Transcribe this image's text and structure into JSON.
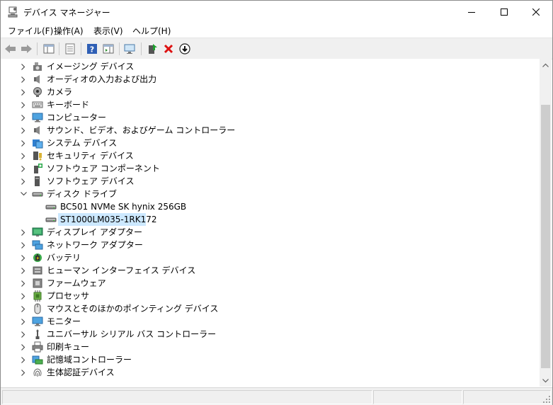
{
  "window": {
    "title": "デバイス マネージャー"
  },
  "menu": [
    {
      "label": "ファイル(F)",
      "name": "menu-file"
    },
    {
      "label": "操作(A)",
      "name": "menu-action"
    },
    {
      "label": "表示(V)",
      "name": "menu-view"
    },
    {
      "label": "ヘルプ(H)",
      "name": "menu-help"
    }
  ],
  "tree": {
    "items": [
      {
        "label": "イメージング デバイス",
        "icon": "camera-device-icon",
        "state": "collapsed"
      },
      {
        "label": "オーディオの入力および出力",
        "icon": "speaker-icon",
        "state": "collapsed"
      },
      {
        "label": "カメラ",
        "icon": "webcam-icon",
        "state": "collapsed"
      },
      {
        "label": "キーボード",
        "icon": "keyboard-icon",
        "state": "collapsed"
      },
      {
        "label": "コンピューター",
        "icon": "monitor-icon",
        "state": "collapsed"
      },
      {
        "label": "サウンド、ビデオ、およびゲーム コントローラー",
        "icon": "speaker-icon",
        "state": "collapsed"
      },
      {
        "label": "システム デバイス",
        "icon": "system-folder-icon",
        "state": "collapsed"
      },
      {
        "label": "セキュリティ デバイス",
        "icon": "security-key-icon",
        "state": "collapsed"
      },
      {
        "label": "ソフトウェア コンポーネント",
        "icon": "software-component-icon",
        "state": "collapsed"
      },
      {
        "label": "ソフトウェア デバイス",
        "icon": "software-device-icon",
        "state": "collapsed"
      },
      {
        "label": "ディスク ドライブ",
        "icon": "disk-drive-icon",
        "state": "expanded"
      },
      {
        "label": "BC501 NVMe SK hynix 256GB",
        "icon": "disk-drive-icon",
        "state": "child"
      },
      {
        "label": "ST1000LM035-1RK172",
        "icon": "disk-drive-icon",
        "state": "child-selected"
      },
      {
        "label": "ディスプレイ アダプター",
        "icon": "display-adapter-icon",
        "state": "collapsed"
      },
      {
        "label": "ネットワーク アダプター",
        "icon": "network-adapter-icon",
        "state": "collapsed"
      },
      {
        "label": "バッテリ",
        "icon": "battery-icon",
        "state": "collapsed"
      },
      {
        "label": "ヒューマン インターフェイス デバイス",
        "icon": "hid-icon",
        "state": "collapsed"
      },
      {
        "label": "ファームウェア",
        "icon": "firmware-icon",
        "state": "collapsed"
      },
      {
        "label": "プロセッサ",
        "icon": "processor-icon",
        "state": "collapsed"
      },
      {
        "label": "マウスとそのほかのポインティング デバイス",
        "icon": "mouse-icon",
        "state": "collapsed"
      },
      {
        "label": "モニター",
        "icon": "monitor-icon",
        "state": "collapsed"
      },
      {
        "label": "ユニバーサル シリアル バス コントローラー",
        "icon": "usb-icon",
        "state": "collapsed"
      },
      {
        "label": "印刷キュー",
        "icon": "printer-icon",
        "state": "collapsed"
      },
      {
        "label": "記憶域コントローラー",
        "icon": "storage-controller-icon",
        "state": "collapsed"
      },
      {
        "label": "生体認証デバイス",
        "icon": "fingerprint-icon",
        "state": "collapsed"
      }
    ]
  },
  "colors": {
    "selection": "#cce8ff",
    "toolbar_bg": "#f0f0f0",
    "scroll_thumb": "#cdcdcd"
  }
}
